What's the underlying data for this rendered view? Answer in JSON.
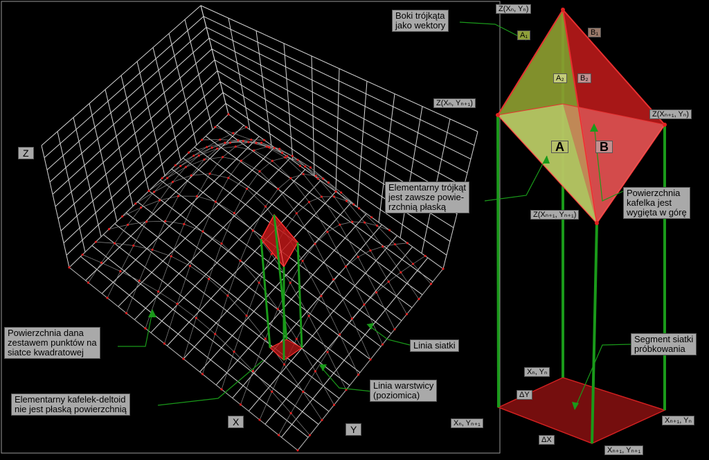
{
  "labels": {
    "axis_z": "Z",
    "axis_x": "X",
    "axis_y": "Y",
    "boki": "Boki trójkąta\njako wektory",
    "elem_trojkat": "Elementarny trójkąt\njest zawsze powie-\nrzchnią płaską",
    "powierzchnia_kafelka": "Powierzchnia\nkafelka jest\nwygięta w górę",
    "powierzchnia_dana": "Powierzchnia dana\nzestawem punktów na\nsiatce kwadratowej",
    "kafelek_deltoid": "Elementarny kafelek-deltoid\nnie jest płaską powierzchnią",
    "linia_siatki": "Linia siatki",
    "linia_warstwicy": "Linia warstwicy\n(poziomica)",
    "segment_siatki": "Segment siatki\npróbkowania",
    "z_top": "Z(Xₙ, Yₙ)",
    "z_left": "Z(Xₙ, Yₙ₊₁)",
    "z_right": "Z(Xₙ₊₁, Yₙ)",
    "z_bottom": "Z(Xₙ₊₁, Yₙ₊₁)",
    "p_top": "Xₙ, Yₙ",
    "p_left": "Xₙ, Yₙ₊₁",
    "p_right": "Xₙ₊₁, Yₙ",
    "p_bottom": "Xₙ₊₁, Yₙ₊₁",
    "delta_y": "ΔY",
    "delta_x": "ΔX",
    "a1": "A₁",
    "a2": "A₂",
    "b1": "B₁",
    "b2": "B₂",
    "a": "A",
    "b": "B"
  },
  "colors": {
    "background": "#000000",
    "grid": "#d8d8d8",
    "mesh_point": "#e02020",
    "green_line": "#1a9a1a",
    "surface_green": "#9aa83a",
    "surface_red": "#c01818",
    "label_bg": "#a9a9a9"
  }
}
